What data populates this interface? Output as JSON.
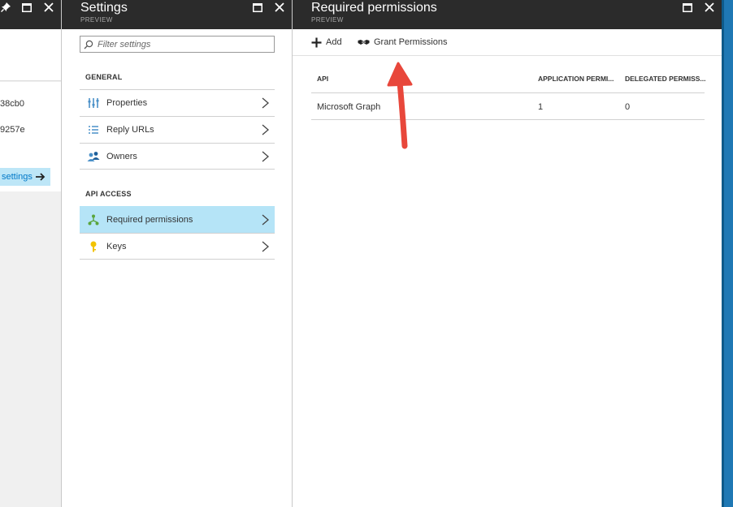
{
  "blade1": {
    "id_line1": "38cb0",
    "id_line2": "9257e",
    "settings_link": "settings"
  },
  "blade2": {
    "title": "Settings",
    "subtitle": "PREVIEW",
    "filter_placeholder": "Filter settings",
    "sections": {
      "general": "GENERAL",
      "api_access": "API ACCESS"
    },
    "items": [
      {
        "label": "Properties",
        "icon": "properties-icon"
      },
      {
        "label": "Reply URLs",
        "icon": "list-icon"
      },
      {
        "label": "Owners",
        "icon": "owners-icon"
      },
      {
        "label": "Required permissions",
        "icon": "permissions-icon"
      },
      {
        "label": "Keys",
        "icon": "key-icon"
      }
    ]
  },
  "blade3": {
    "title": "Required permissions",
    "subtitle": "PREVIEW",
    "toolbar": {
      "add_label": "Add",
      "grant_label": "Grant Permissions"
    },
    "table": {
      "headers": [
        "API",
        "APPLICATION PERMI...",
        "DELEGATED PERMISS..."
      ],
      "rows": [
        {
          "api": "Microsoft Graph",
          "application": "1",
          "delegated": "0"
        }
      ]
    }
  },
  "colors": {
    "header_bg": "#2b2b2b",
    "selected_bg": "#b5e4f7",
    "accent": "#0078c8",
    "arrow": "#e8473b",
    "scrollbar": "#1f78b4"
  }
}
